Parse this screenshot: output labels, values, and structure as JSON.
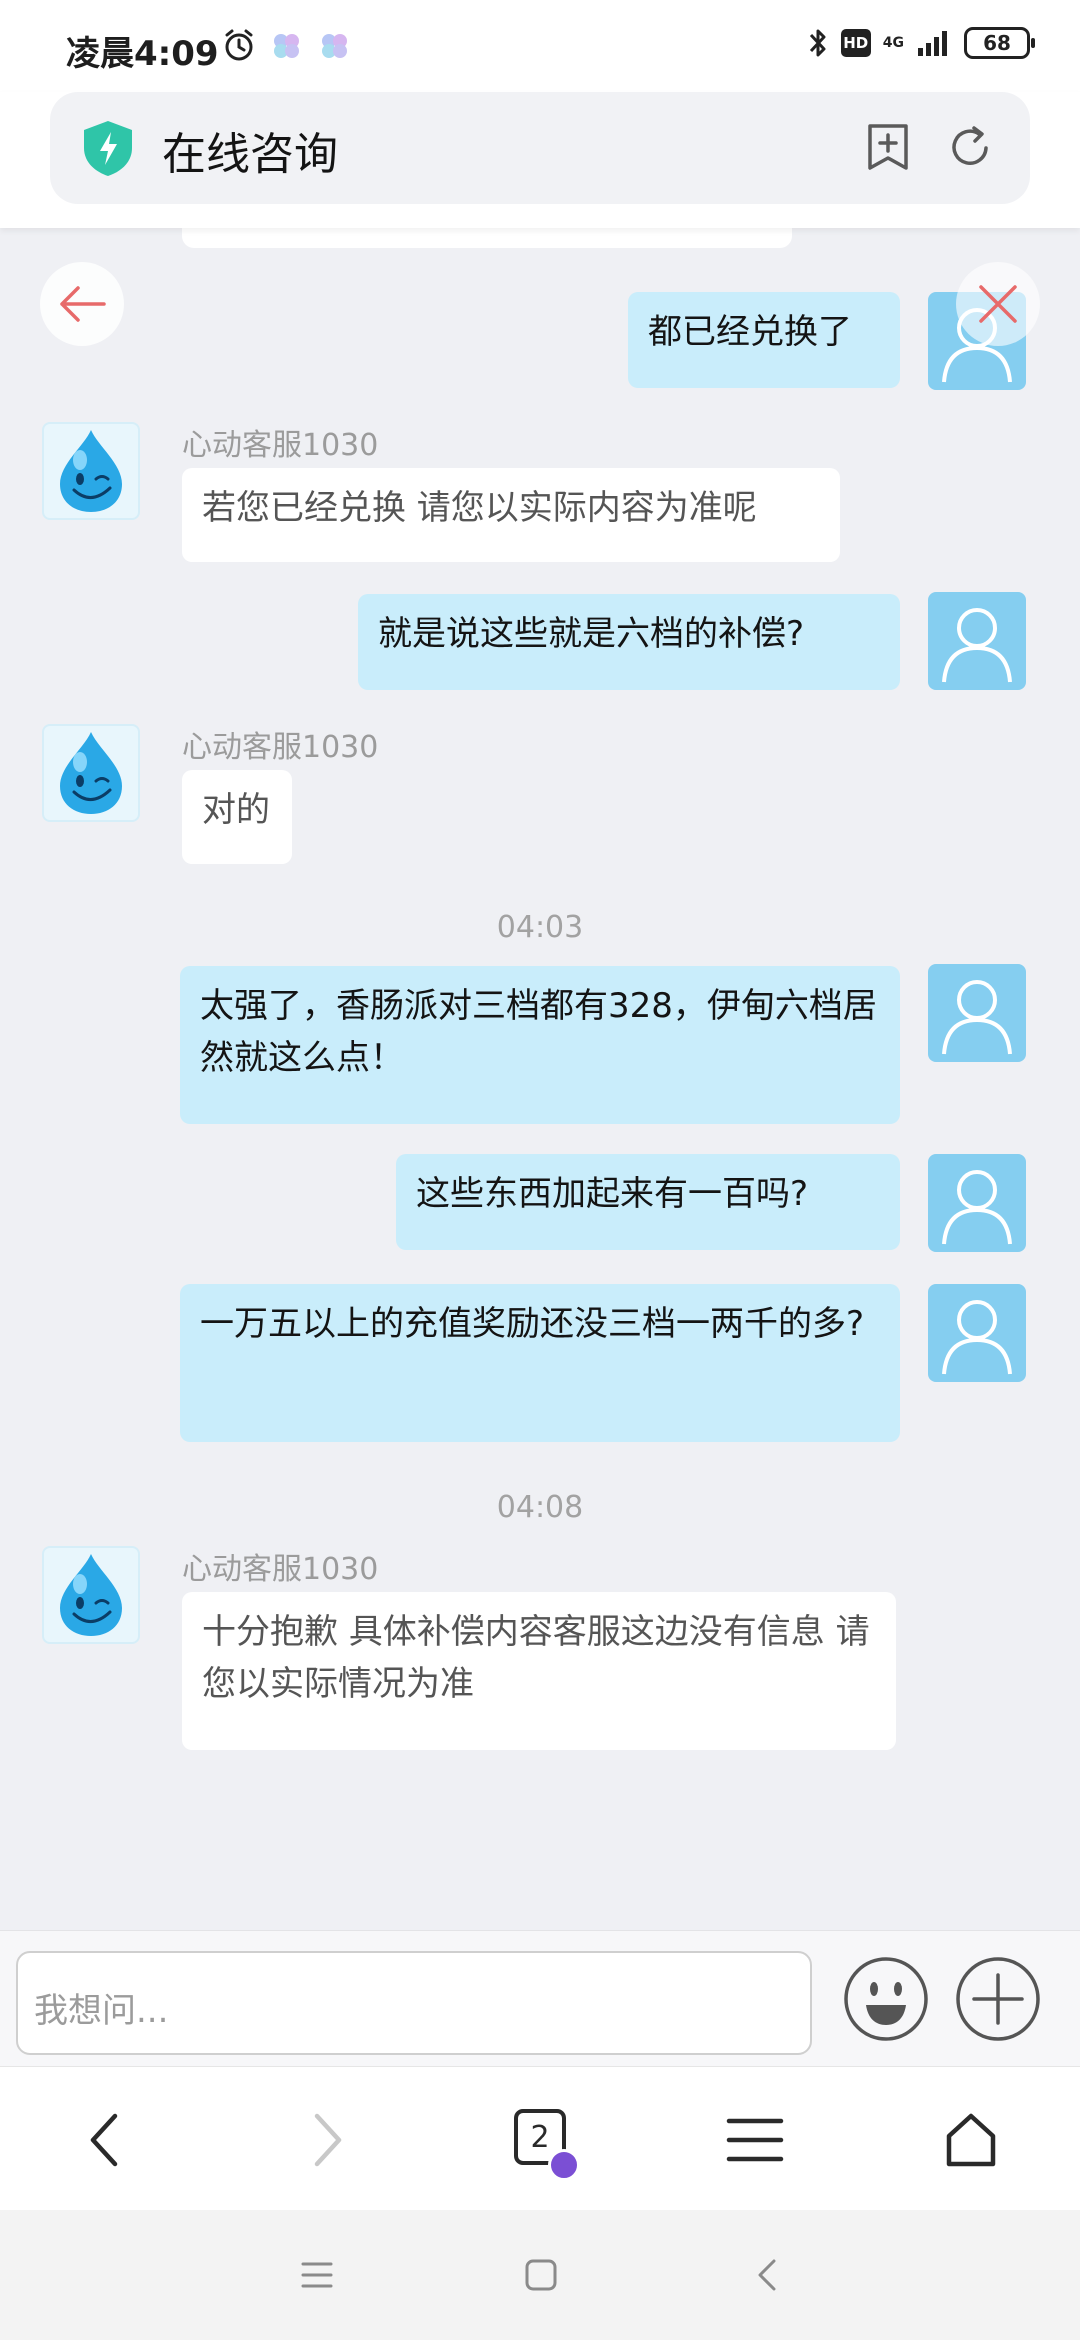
{
  "status_bar": {
    "time": "凌晨4:09",
    "hd_label": "HD",
    "network_label": "4G",
    "battery_level": "68"
  },
  "header": {
    "title": "在线咨询"
  },
  "colors": {
    "user_bubble": "#c9edfb",
    "agent_bubble": "#ffffff",
    "background": "#eff0f4",
    "shield_green": "#2fc5a8",
    "back_arrow_red": "#e76a6a"
  },
  "chat": {
    "messages": [
      {
        "role": "user",
        "text": "都已经兑换了"
      },
      {
        "role": "agent",
        "name": "心动客服1030",
        "text": "若您已经兑换 请您以实际内容为准呢"
      },
      {
        "role": "user",
        "text": "就是说这些就是六档的补偿?"
      },
      {
        "role": "agent",
        "name": "心动客服1030",
        "text": "对的"
      },
      {
        "role": "time",
        "text": "04:03"
      },
      {
        "role": "user",
        "text": "太强了，香肠派对三档都有328，伊甸六档居然就这么点！"
      },
      {
        "role": "user",
        "text": "这些东西加起来有一百吗?"
      },
      {
        "role": "user",
        "text": "一万五以上的充值奖励还没三档一两千的多?"
      },
      {
        "role": "time",
        "text": "04:08"
      },
      {
        "role": "agent",
        "name": "心动客服1030",
        "text": "十分抱歉 具体补偿内容客服这边没有信息 请您以实际情况为准"
      }
    ]
  },
  "input": {
    "placeholder": "我想问..."
  },
  "browser_nav": {
    "tab_count": "2"
  }
}
